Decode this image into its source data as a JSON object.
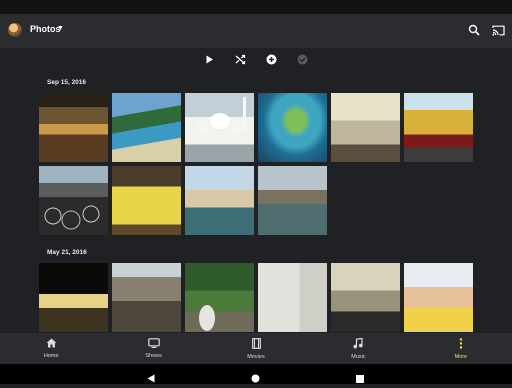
{
  "app": {
    "title": "Photos"
  },
  "sections": [
    {
      "date": "Sep 15, 2016"
    },
    {
      "date": "May 21, 2016"
    }
  ],
  "nav": [
    {
      "label": "Home",
      "icon": "home-icon"
    },
    {
      "label": "Shows",
      "icon": "tv-icon"
    },
    {
      "label": "Movies",
      "icon": "film-icon"
    },
    {
      "label": "Music",
      "icon": "music-note-icon"
    },
    {
      "label": "More",
      "icon": "more-vert-icon"
    }
  ],
  "colors": {
    "accent": "#f0e04a",
    "background": "#202124",
    "bar": "#2b2c30"
  }
}
